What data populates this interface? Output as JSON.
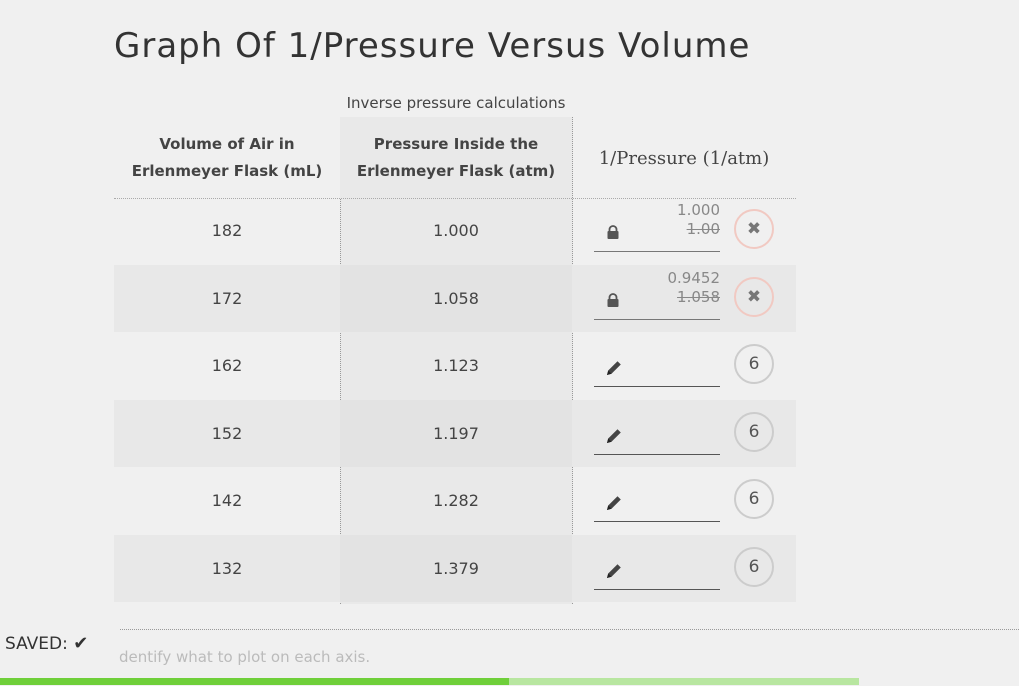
{
  "title": "Graph Of 1/Pressure Versus Volume",
  "table": {
    "caption": "Inverse pressure calculations",
    "headers": {
      "col1_line1": "Volume of Air in",
      "col1_line2": "Erlenmeyer Flask (mL)",
      "col2_line1": "Pressure Inside the",
      "col2_line2": "Erlenmeyer Flask (atm)",
      "col3": "1/Pressure (1/atm)"
    },
    "rows": [
      {
        "volume": "182",
        "pressure": "1.000",
        "state": "locked",
        "answer_new": "1.000",
        "answer_old": "1.00",
        "badge": "✖",
        "badge_state": "incorrect"
      },
      {
        "volume": "172",
        "pressure": "1.058",
        "state": "locked",
        "answer_new": "0.9452",
        "answer_old": "1.058",
        "badge": "✖",
        "badge_state": "incorrect"
      },
      {
        "volume": "162",
        "pressure": "1.123",
        "state": "editable",
        "answer_new": "",
        "answer_old": "",
        "badge": "6",
        "badge_state": "attempts"
      },
      {
        "volume": "152",
        "pressure": "1.197",
        "state": "editable",
        "answer_new": "",
        "answer_old": "",
        "badge": "6",
        "badge_state": "attempts"
      },
      {
        "volume": "142",
        "pressure": "1.282",
        "state": "editable",
        "answer_new": "",
        "answer_old": "",
        "badge": "6",
        "badge_state": "attempts"
      },
      {
        "volume": "132",
        "pressure": "1.379",
        "state": "editable",
        "answer_new": "",
        "answer_old": "",
        "badge": "6",
        "badge_state": "attempts"
      }
    ]
  },
  "footer": {
    "saved_label": "SAVED:",
    "saved_icon": "check-icon",
    "hint_text": "dentify what to plot on each axis."
  },
  "progress": {
    "fraction": 0.592
  },
  "colors": {
    "progress_fill": "#6fcf3a",
    "progress_track": "#b8e6a0",
    "error_ring": "#f1c9c2"
  }
}
